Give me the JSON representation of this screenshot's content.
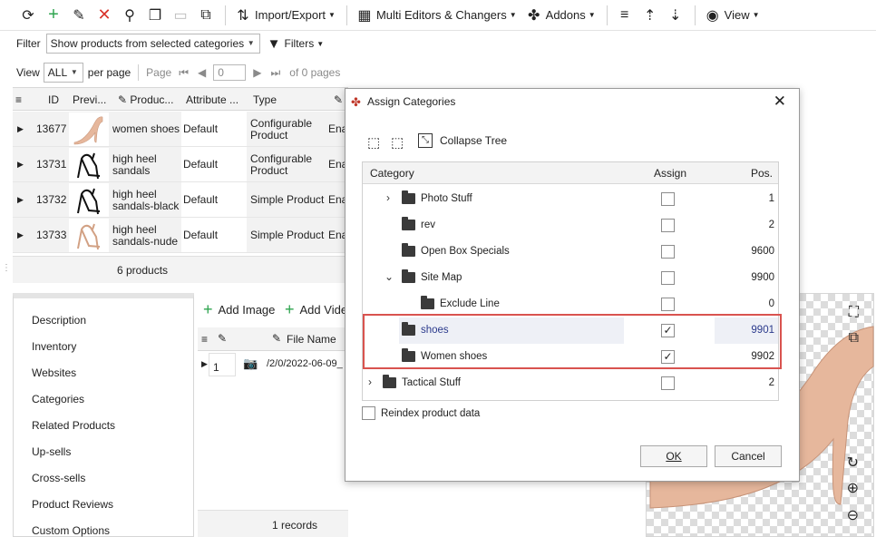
{
  "toolbar": {
    "import_export": "Import/Export",
    "multi_editors": "Multi Editors & Changers",
    "addons": "Addons",
    "view": "View"
  },
  "filter": {
    "label": "Filter",
    "value": "Show products from selected categories",
    "filters_label": "Filters"
  },
  "pager": {
    "view_label": "View",
    "view_value": "ALL",
    "per_page": "per page",
    "page_label": "Page",
    "page_value": "0",
    "of_pages": "of 0 pages"
  },
  "grid": {
    "columns": [
      "ID",
      "Previ...",
      "Produc...",
      "Attribute ...",
      "Type"
    ],
    "rows": [
      {
        "id": "13677",
        "name": "women shoes",
        "attr": "Default",
        "type": "Configurable Product",
        "status": "Ena"
      },
      {
        "id": "13731",
        "name": "high heel sandals",
        "attr": "Default",
        "type": "Configurable Product",
        "status": "Ena"
      },
      {
        "id": "13732",
        "name": "high heel sandals-black",
        "attr": "Default",
        "type": "Simple Product",
        "status": "Ena"
      },
      {
        "id": "13733",
        "name": "high heel sandals-nude",
        "attr": "Default",
        "type": "Simple Product",
        "status": "Ena"
      }
    ],
    "footer": "6 products"
  },
  "side_items": [
    "Description",
    "Inventory",
    "Websites",
    "Categories",
    "Related Products",
    "Up-sells",
    "Cross-sells",
    "Product Reviews",
    "Custom Options"
  ],
  "images_panel": {
    "add_image": "Add Image",
    "add_video": "Add Vide",
    "file_name_header": "File Name",
    "row_index": "1",
    "row_file": "/2/0/2022-06-09_",
    "footer": "1 records"
  },
  "dialog": {
    "title": "Assign Categories",
    "collapse_tree": "Collapse Tree",
    "headers": {
      "category": "Category",
      "assign": "Assign",
      "pos": "Pos."
    },
    "rows": [
      {
        "name": "Photo Stuff",
        "checked": false,
        "pos": "1"
      },
      {
        "name": "rev",
        "checked": false,
        "pos": "2"
      },
      {
        "name": "Open Box Specials",
        "checked": false,
        "pos": "9600"
      },
      {
        "name": "Site Map",
        "checked": false,
        "pos": "9900"
      },
      {
        "name": "Exclude Line",
        "checked": false,
        "pos": "0"
      },
      {
        "name": "shoes",
        "checked": true,
        "pos": "9901"
      },
      {
        "name": "Women shoes",
        "checked": true,
        "pos": "9902"
      },
      {
        "name": "Tactical Stuff",
        "checked": false,
        "pos": "2"
      }
    ],
    "reindex_label": "Reindex product data",
    "ok": "OK",
    "cancel": "Cancel"
  },
  "colors": {
    "highlight_red": "#d9534f",
    "selected_text": "#2b3a8c",
    "add_green": "#2ea44f"
  }
}
